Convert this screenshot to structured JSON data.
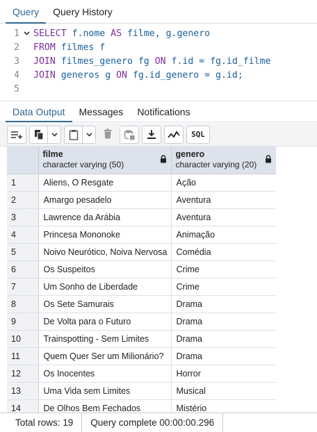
{
  "query_tabs": [
    {
      "label": "Query",
      "active": true
    },
    {
      "label": "Query History",
      "active": false
    }
  ],
  "editor": {
    "lines": [
      {
        "num": "1",
        "fold": "chevron-down-icon"
      },
      {
        "num": "2"
      },
      {
        "num": "3"
      },
      {
        "num": "4"
      },
      {
        "num": "5"
      }
    ],
    "code": {
      "l1_kw1": "SELECT",
      "l1_t1": " f.nome ",
      "l1_kw2": "AS",
      "l1_t2": " filme, g.genero",
      "l2_kw1": "FROM",
      "l2_t1": " filmes f",
      "l3_kw1": "JOIN",
      "l3_t1": " filmes_genero fg ",
      "l3_kw2": "ON",
      "l3_t2": " f.id = fg.id_filme",
      "l4_kw1": "JOIN",
      "l4_t1": " generos g ",
      "l4_kw2": "ON",
      "l4_t2": " fg.id_genero = g.id;"
    }
  },
  "result_tabs": [
    {
      "label": "Data Output",
      "active": true
    },
    {
      "label": "Messages",
      "active": false
    },
    {
      "label": "Notifications",
      "active": false
    }
  ],
  "toolbar": {
    "icons": [
      "add-row-icon",
      "copy-icon",
      "chevron-down-icon",
      "paste-icon",
      "chevron-down-icon",
      "delete-icon",
      "save-data-icon",
      "download-icon",
      "graph-icon"
    ],
    "sql_label": "SQL"
  },
  "grid": {
    "columns": [
      {
        "name": "filme",
        "type": "character varying (50)"
      },
      {
        "name": "genero",
        "type": "character varying (20)"
      }
    ],
    "rows": [
      [
        "1",
        "Aliens, O Resgate",
        "Ação"
      ],
      [
        "2",
        "Amargo pesadelo",
        "Aventura"
      ],
      [
        "3",
        "Lawrence da Arábia",
        "Aventura"
      ],
      [
        "4",
        "Princesa Mononoke",
        "Animação"
      ],
      [
        "5",
        "Noivo Neurótico, Noiva Nervosa",
        "Comédia"
      ],
      [
        "6",
        "Os Suspeitos",
        "Crime"
      ],
      [
        "7",
        "Um Sonho de Liberdade",
        "Crime"
      ],
      [
        "8",
        "Os Sete Samurais",
        "Drama"
      ],
      [
        "9",
        "De Volta para o Futuro",
        "Drama"
      ],
      [
        "10",
        "Trainspotting - Sem Limites",
        "Drama"
      ],
      [
        "11",
        "Quem Quer Ser um Milionário?",
        "Drama"
      ],
      [
        "12",
        "Os Inocentes",
        "Horror"
      ],
      [
        "13",
        "Uma Vida sem Limites",
        "Musical"
      ],
      [
        "14",
        "De Olhos Bem Fechados",
        "Mistério"
      ]
    ]
  },
  "status": {
    "total_rows": "Total rows: 19",
    "query_complete": "Query complete 00:00:00.296"
  },
  "colors": {
    "accent": "#326690",
    "keyword": "#7a2e9c",
    "identifier": "#1a5f9a",
    "header_bg": "#dde3ec"
  }
}
